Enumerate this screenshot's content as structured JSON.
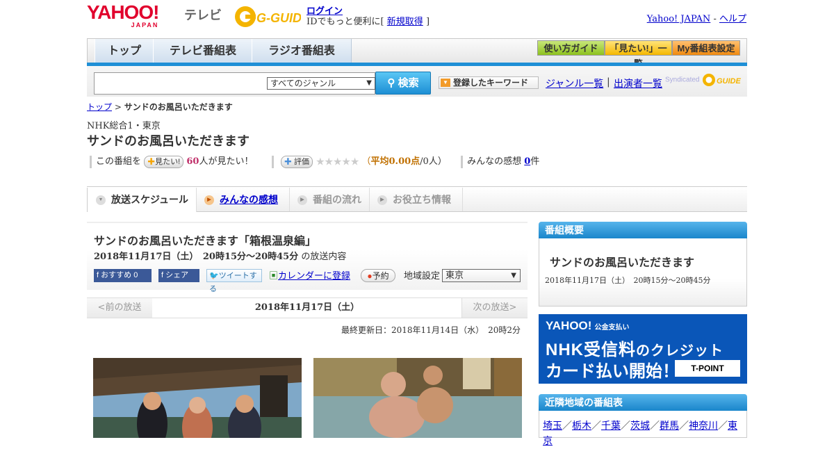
{
  "header": {
    "logo_text": "YAHOO!",
    "logo_sub": "JAPAN",
    "service": "テレビ",
    "gguide": "G-GUIDE",
    "login": "ログイン",
    "login_sub_prefix": "IDでもっと便利に[",
    "signup": "新規取得",
    "login_sub_suffix": "]",
    "yahoo_japan": "Yahoo! JAPAN",
    "sep": " - ",
    "help": "ヘルプ"
  },
  "nav": {
    "tabs": [
      "トップ",
      "テレビ番組表",
      "ラジオ番組表"
    ],
    "guide_buttons": [
      "使い方ガイド",
      "「見たい!」一覧",
      "My番組表設定"
    ]
  },
  "search": {
    "placeholder": "",
    "genre_selected": "すべてのジャンル",
    "button": "検索",
    "keyword_button": "登録したキーワード",
    "genre_list": "ジャンル一覧",
    "separator": "|",
    "performer_list": "出演者一覧",
    "syndicated": "Syndicated"
  },
  "breadcrumb": {
    "top": "トップ",
    "sep": " > ",
    "current": "サンドのお風呂いただきます"
  },
  "program": {
    "channel": "NHK総合1・東京",
    "title": "サンドのお風呂いただきます",
    "want_prefix": "この番組を",
    "want_button": "見たい!",
    "want_count": "60",
    "want_suffix": "人が見たい！",
    "rate_button": "評価",
    "stars": "★★★★★",
    "avg_prefix": "（",
    "avg_label": "平均0.00点",
    "avg_suffix": "/0人）",
    "impressions_prefix": "みんなの感想",
    "impressions_count": "0",
    "impressions_suffix": "件"
  },
  "tabs": [
    "放送スケジュール",
    "みんなの感想",
    "番組の流れ",
    "お役立ち情報"
  ],
  "episode": {
    "title": "サンドのお風呂いただきます「箱根温泉編」",
    "datetime": "2018年11月17日（土）　20時15分～20時45分",
    "content_label": "の放送内容",
    "recommend": "おすすめ",
    "recommend_count": "0",
    "share": "シェア",
    "tweet": "ツイートする",
    "calendar": "カレンダーに登録",
    "reserve": "予約",
    "region_label": "地域設定",
    "region": "東京"
  },
  "pager": {
    "prev": "<前の放送",
    "current": "2018年11月17日（土）",
    "next": "次の放送>"
  },
  "updated": "最終更新日：2018年11月14日（水）　20時2分",
  "sidebar": {
    "summary_head": "番組概要",
    "summary_title": "サンドのお風呂いただきます",
    "summary_time": "2018年11月17日（土）　20時15分～20時45分",
    "ad_brand": "YAHOO!",
    "ad_brand_sub": "公金支払い",
    "ad_line1": "NHK受信料",
    "ad_line1b": "のクレジット",
    "ad_line2": "カード払い開始！",
    "ad_tpoint": "T-POINT",
    "nearby_head": "近隣地域の番組表",
    "nearby": [
      "埼玉",
      "栃木",
      "千葉",
      "茨城",
      "群馬",
      "神奈川",
      "東京"
    ]
  },
  "colors": {
    "accent_blue": "#1a86cb",
    "yahoo_red": "#e1002d",
    "link": "#0000cc",
    "ad_bg": "#0a56b8"
  }
}
